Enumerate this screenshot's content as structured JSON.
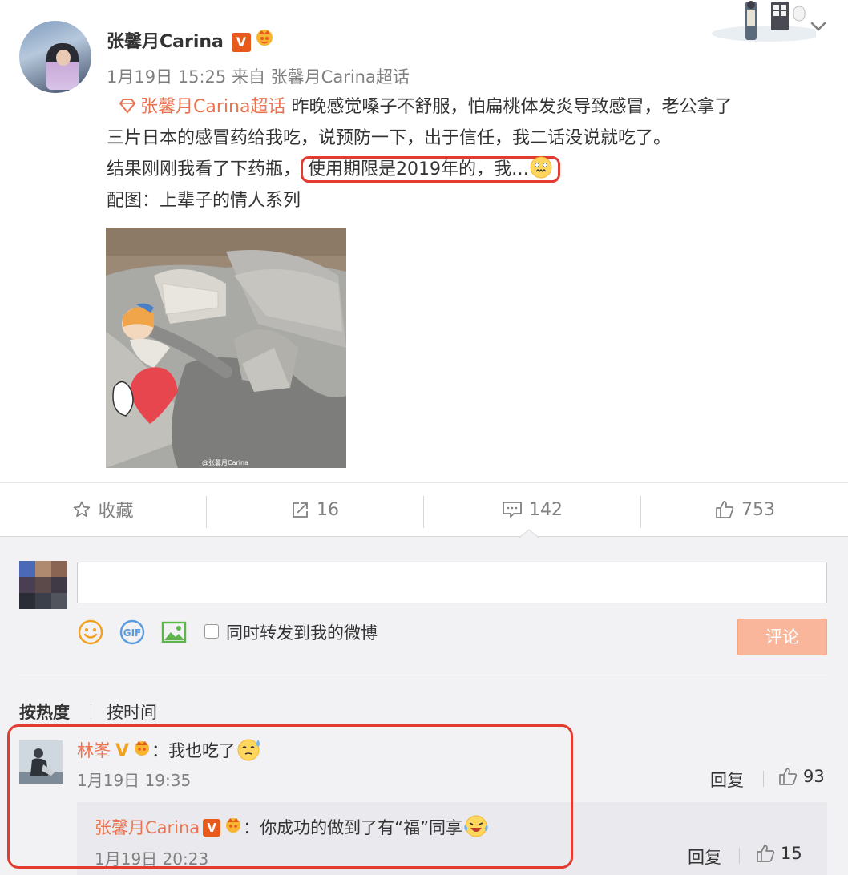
{
  "post": {
    "author": "张馨月Carina",
    "badge_v": "V",
    "date": "1月19日 15:25",
    "source_prefix": "来自",
    "source": "张馨月Carina超话",
    "topic": "张馨月Carina超话",
    "line1": "昨晚感觉嗓子不舒服，怕扁桃体发炎导致感冒，老公拿了",
    "line2": "三片日本的感冒药给我吃，说预防一下，出于信任，我二话没说就吃了。",
    "line3a": "结果刚刚我看了下药瓶，",
    "line3b": "使用期限是2019年的，我…",
    "line4": "配图：上辈子的情人系列",
    "image_watermark": "@张馨月Carina"
  },
  "actions": {
    "favorite_label": "收藏",
    "repost_count": "16",
    "comment_count": "142",
    "like_count": "753"
  },
  "composer": {
    "placeholder": "",
    "also_repost_label": "同时转发到我的微博",
    "submit_label": "评论"
  },
  "sort": {
    "hot_label": "按热度",
    "time_label": "按时间"
  },
  "comments": [
    {
      "user": "林峯",
      "badge_v": "V",
      "colon": "：",
      "text": "我也吃了",
      "time": "1月19日 19:35",
      "reply_label": "回复",
      "likes": "93",
      "reply": {
        "user": "张馨月Carina",
        "badge_v": "V",
        "colon": "：",
        "text": "你成功的做到了有“福”同享",
        "time": "1月19日 20:23",
        "reply_label": "回复",
        "likes": "15"
      }
    }
  ],
  "colors": {
    "accent_link": "#eb7350",
    "highlight_frame": "#e23b32",
    "submit_disabled": "#f9b69b",
    "verified_orange": "#e8591c"
  },
  "icons": [
    "star-icon",
    "repost-icon",
    "comment-icon",
    "thumbs-up-icon",
    "smiley-icon",
    "gif-icon",
    "image-icon",
    "chevron-down-icon",
    "topic-diamond-icon"
  ]
}
